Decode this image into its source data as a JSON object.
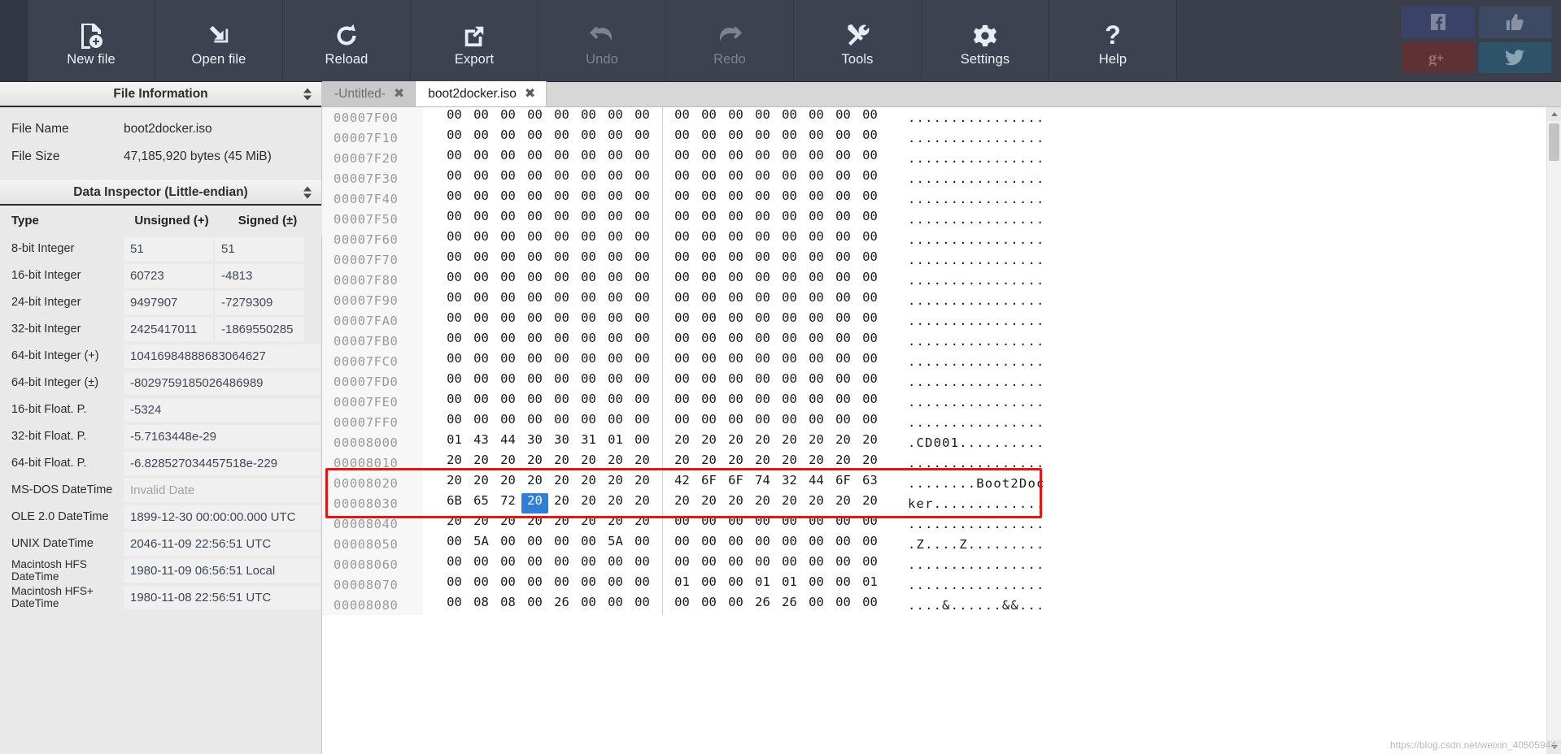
{
  "toolbar": {
    "buttons": [
      {
        "label": "New file",
        "icon": "new-file-icon",
        "disabled": false
      },
      {
        "label": "Open file",
        "icon": "open-file-icon",
        "disabled": false
      },
      {
        "label": "Reload",
        "icon": "reload-icon",
        "disabled": false
      },
      {
        "label": "Export",
        "icon": "export-icon",
        "disabled": false
      },
      {
        "label": "Undo",
        "icon": "undo-icon",
        "disabled": true
      },
      {
        "label": "Redo",
        "icon": "redo-icon",
        "disabled": true
      },
      {
        "label": "Tools",
        "icon": "tools-icon",
        "disabled": false
      },
      {
        "label": "Settings",
        "icon": "gear-icon",
        "disabled": false
      },
      {
        "label": "Help",
        "icon": "question-mark-icon",
        "disabled": false
      }
    ],
    "social": [
      {
        "name": "facebook-icon",
        "color": "#3a4268"
      },
      {
        "name": "thumbs-up-icon",
        "color": "#3c4a63"
      },
      {
        "name": "google-plus-icon",
        "color": "#5e3235"
      },
      {
        "name": "twitter-icon",
        "color": "#2e5268"
      }
    ]
  },
  "file_information": {
    "title": "File Information",
    "rows": [
      {
        "key": "File Name",
        "value": "boot2docker.iso"
      },
      {
        "key": "File Size",
        "value": "47,185,920 bytes (45 MiB)"
      }
    ]
  },
  "data_inspector": {
    "title": "Data Inspector (Little-endian)",
    "columns": [
      "Type",
      "Unsigned (+)",
      "Signed (±)"
    ],
    "rows": [
      {
        "type": "8-bit Integer",
        "unsigned": "51",
        "signed": "51",
        "wide": false
      },
      {
        "type": "16-bit Integer",
        "unsigned": "60723",
        "signed": "-4813",
        "wide": false
      },
      {
        "type": "24-bit Integer",
        "unsigned": "9497907",
        "signed": "-7279309",
        "wide": false
      },
      {
        "type": "32-bit Integer",
        "unsigned": "2425417011",
        "signed": "-1869550285",
        "wide": false
      },
      {
        "type": "64-bit Integer (+)",
        "unsigned": "10416984888683064627",
        "signed": "",
        "wide": true
      },
      {
        "type": "64-bit Integer (±)",
        "unsigned": "-8029759185026486989",
        "signed": "",
        "wide": true
      },
      {
        "type": "16-bit Float. P.",
        "unsigned": "-5324",
        "signed": "",
        "wide": true
      },
      {
        "type": "32-bit Float. P.",
        "unsigned": "-5.7163448e-29",
        "signed": "",
        "wide": true
      },
      {
        "type": "64-bit Float. P.",
        "unsigned": "-6.828527034457518e-229",
        "signed": "",
        "wide": true
      },
      {
        "type": "MS-DOS DateTime",
        "unsigned": "Invalid Date",
        "signed": "",
        "wide": true,
        "muted": true
      },
      {
        "type": "OLE 2.0 DateTime",
        "unsigned": "1899-12-30 00:00:00.000 UTC",
        "signed": "",
        "wide": true
      },
      {
        "type": "UNIX DateTime",
        "unsigned": "2046-11-09 22:56:51 UTC",
        "signed": "",
        "wide": true
      },
      {
        "type": "Macintosh HFS DateTime",
        "unsigned": "1980-11-09 06:56:51 Local",
        "signed": "",
        "wide": true,
        "two_line": true
      },
      {
        "type": "Macintosh HFS+ DateTime",
        "unsigned": "1980-11-08 22:56:51 UTC",
        "signed": "",
        "wide": true,
        "two_line": true
      }
    ]
  },
  "tabs": [
    {
      "label": "-Untitled-",
      "active": false,
      "close": "✖"
    },
    {
      "label": "boot2docker.iso",
      "active": true,
      "close": "✖"
    }
  ],
  "hex_view": {
    "selected_byte": {
      "row_offset": "00008030",
      "index": 3,
      "value": "20"
    },
    "highlight_box": {
      "color": "#e8140f",
      "rows": [
        "00008020",
        "00008030"
      ]
    },
    "rows": [
      {
        "offset": "00007F00",
        "bytes": [
          "00",
          "00",
          "00",
          "00",
          "00",
          "00",
          "00",
          "00",
          "00",
          "00",
          "00",
          "00",
          "00",
          "00",
          "00",
          "00"
        ],
        "ascii": "................"
      },
      {
        "offset": "00007F10",
        "bytes": [
          "00",
          "00",
          "00",
          "00",
          "00",
          "00",
          "00",
          "00",
          "00",
          "00",
          "00",
          "00",
          "00",
          "00",
          "00",
          "00"
        ],
        "ascii": "................"
      },
      {
        "offset": "00007F20",
        "bytes": [
          "00",
          "00",
          "00",
          "00",
          "00",
          "00",
          "00",
          "00",
          "00",
          "00",
          "00",
          "00",
          "00",
          "00",
          "00",
          "00"
        ],
        "ascii": "................"
      },
      {
        "offset": "00007F30",
        "bytes": [
          "00",
          "00",
          "00",
          "00",
          "00",
          "00",
          "00",
          "00",
          "00",
          "00",
          "00",
          "00",
          "00",
          "00",
          "00",
          "00"
        ],
        "ascii": "................"
      },
      {
        "offset": "00007F40",
        "bytes": [
          "00",
          "00",
          "00",
          "00",
          "00",
          "00",
          "00",
          "00",
          "00",
          "00",
          "00",
          "00",
          "00",
          "00",
          "00",
          "00"
        ],
        "ascii": "................"
      },
      {
        "offset": "00007F50",
        "bytes": [
          "00",
          "00",
          "00",
          "00",
          "00",
          "00",
          "00",
          "00",
          "00",
          "00",
          "00",
          "00",
          "00",
          "00",
          "00",
          "00"
        ],
        "ascii": "................"
      },
      {
        "offset": "00007F60",
        "bytes": [
          "00",
          "00",
          "00",
          "00",
          "00",
          "00",
          "00",
          "00",
          "00",
          "00",
          "00",
          "00",
          "00",
          "00",
          "00",
          "00"
        ],
        "ascii": "................"
      },
      {
        "offset": "00007F70",
        "bytes": [
          "00",
          "00",
          "00",
          "00",
          "00",
          "00",
          "00",
          "00",
          "00",
          "00",
          "00",
          "00",
          "00",
          "00",
          "00",
          "00"
        ],
        "ascii": "................"
      },
      {
        "offset": "00007F80",
        "bytes": [
          "00",
          "00",
          "00",
          "00",
          "00",
          "00",
          "00",
          "00",
          "00",
          "00",
          "00",
          "00",
          "00",
          "00",
          "00",
          "00"
        ],
        "ascii": "................"
      },
      {
        "offset": "00007F90",
        "bytes": [
          "00",
          "00",
          "00",
          "00",
          "00",
          "00",
          "00",
          "00",
          "00",
          "00",
          "00",
          "00",
          "00",
          "00",
          "00",
          "00"
        ],
        "ascii": "................"
      },
      {
        "offset": "00007FA0",
        "bytes": [
          "00",
          "00",
          "00",
          "00",
          "00",
          "00",
          "00",
          "00",
          "00",
          "00",
          "00",
          "00",
          "00",
          "00",
          "00",
          "00"
        ],
        "ascii": "................"
      },
      {
        "offset": "00007FB0",
        "bytes": [
          "00",
          "00",
          "00",
          "00",
          "00",
          "00",
          "00",
          "00",
          "00",
          "00",
          "00",
          "00",
          "00",
          "00",
          "00",
          "00"
        ],
        "ascii": "................"
      },
      {
        "offset": "00007FC0",
        "bytes": [
          "00",
          "00",
          "00",
          "00",
          "00",
          "00",
          "00",
          "00",
          "00",
          "00",
          "00",
          "00",
          "00",
          "00",
          "00",
          "00"
        ],
        "ascii": "................"
      },
      {
        "offset": "00007FD0",
        "bytes": [
          "00",
          "00",
          "00",
          "00",
          "00",
          "00",
          "00",
          "00",
          "00",
          "00",
          "00",
          "00",
          "00",
          "00",
          "00",
          "00"
        ],
        "ascii": "................"
      },
      {
        "offset": "00007FE0",
        "bytes": [
          "00",
          "00",
          "00",
          "00",
          "00",
          "00",
          "00",
          "00",
          "00",
          "00",
          "00",
          "00",
          "00",
          "00",
          "00",
          "00"
        ],
        "ascii": "................"
      },
      {
        "offset": "00007FF0",
        "bytes": [
          "00",
          "00",
          "00",
          "00",
          "00",
          "00",
          "00",
          "00",
          "00",
          "00",
          "00",
          "00",
          "00",
          "00",
          "00",
          "00"
        ],
        "ascii": "................"
      },
      {
        "offset": "00008000",
        "bytes": [
          "01",
          "43",
          "44",
          "30",
          "30",
          "31",
          "01",
          "00",
          "20",
          "20",
          "20",
          "20",
          "20",
          "20",
          "20",
          "20"
        ],
        "ascii": ".CD001.........."
      },
      {
        "offset": "00008010",
        "bytes": [
          "20",
          "20",
          "20",
          "20",
          "20",
          "20",
          "20",
          "20",
          "20",
          "20",
          "20",
          "20",
          "20",
          "20",
          "20",
          "20"
        ],
        "ascii": "................"
      },
      {
        "offset": "00008020",
        "bytes": [
          "20",
          "20",
          "20",
          "20",
          "20",
          "20",
          "20",
          "20",
          "42",
          "6F",
          "6F",
          "74",
          "32",
          "44",
          "6F",
          "63"
        ],
        "ascii": "........Boot2Doc"
      },
      {
        "offset": "00008030",
        "bytes": [
          "6B",
          "65",
          "72",
          "20",
          "20",
          "20",
          "20",
          "20",
          "20",
          "20",
          "20",
          "20",
          "20",
          "20",
          "20",
          "20"
        ],
        "ascii": "ker............."
      },
      {
        "offset": "00008040",
        "bytes": [
          "20",
          "20",
          "20",
          "20",
          "20",
          "20",
          "20",
          "20",
          "00",
          "00",
          "00",
          "00",
          "00",
          "00",
          "00",
          "00"
        ],
        "ascii": "................"
      },
      {
        "offset": "00008050",
        "bytes": [
          "00",
          "5A",
          "00",
          "00",
          "00",
          "00",
          "5A",
          "00",
          "00",
          "00",
          "00",
          "00",
          "00",
          "00",
          "00",
          "00"
        ],
        "ascii": ".Z....Z........."
      },
      {
        "offset": "00008060",
        "bytes": [
          "00",
          "00",
          "00",
          "00",
          "00",
          "00",
          "00",
          "00",
          "00",
          "00",
          "00",
          "00",
          "00",
          "00",
          "00",
          "00"
        ],
        "ascii": "................"
      },
      {
        "offset": "00008070",
        "bytes": [
          "00",
          "00",
          "00",
          "00",
          "00",
          "00",
          "00",
          "00",
          "01",
          "00",
          "00",
          "01",
          "01",
          "00",
          "00",
          "01"
        ],
        "ascii": "................"
      },
      {
        "offset": "00008080",
        "bytes": [
          "00",
          "08",
          "08",
          "00",
          "26",
          "00",
          "00",
          "00",
          "00",
          "00",
          "00",
          "26",
          "26",
          "00",
          "00",
          "00"
        ],
        "ascii": "....&......&&..."
      }
    ]
  },
  "watermark": "https://blog.csdn.net/weixin_40505944"
}
